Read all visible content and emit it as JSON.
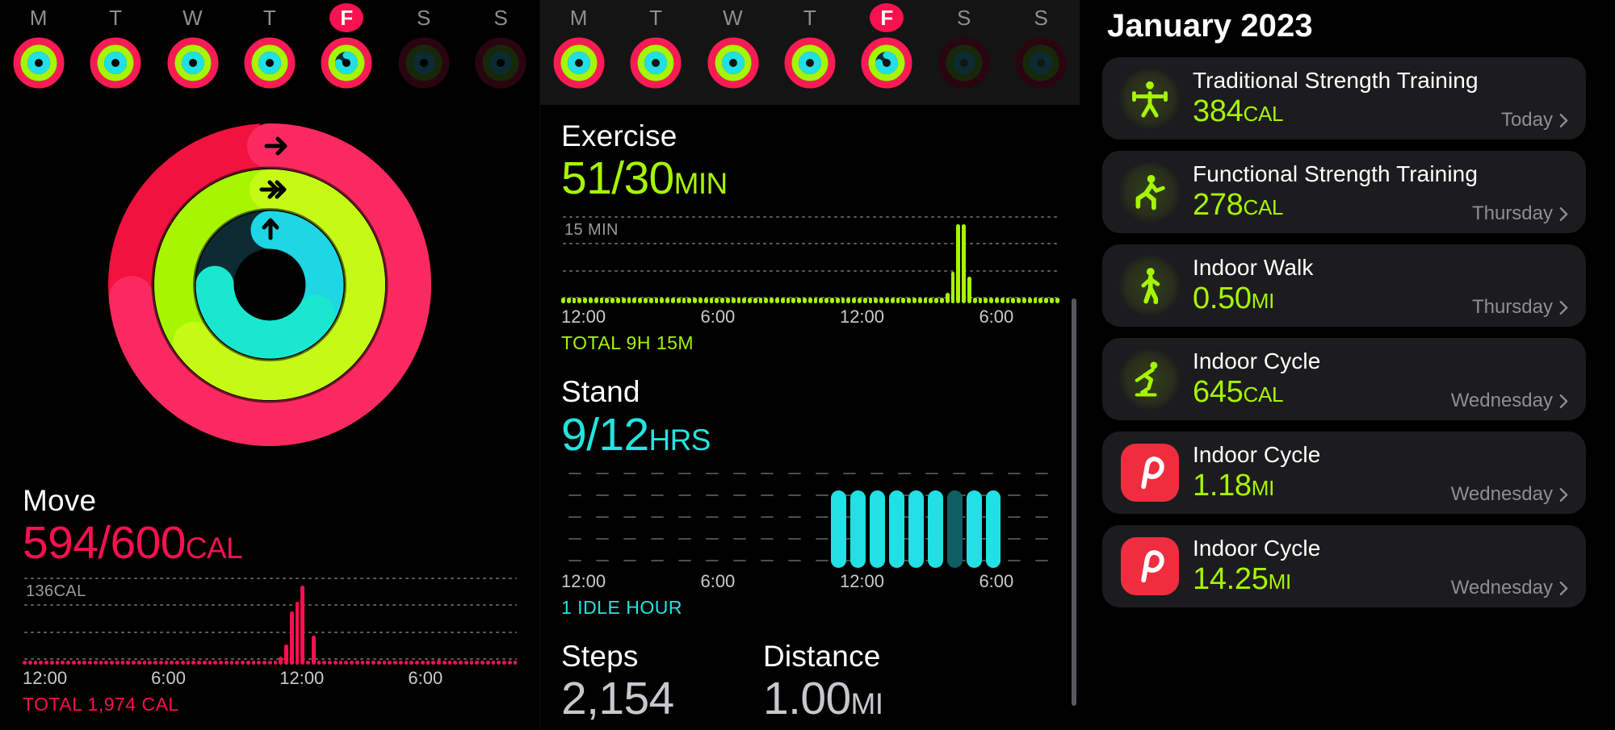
{
  "week_strip": {
    "days": [
      {
        "label": "M",
        "today": false,
        "move_pct": 113,
        "exercise_pct": 100,
        "stand_pct": 100,
        "dimmed": false
      },
      {
        "label": "T",
        "today": false,
        "move_pct": 108,
        "exercise_pct": 100,
        "stand_pct": 100,
        "dimmed": false
      },
      {
        "label": "W",
        "today": false,
        "move_pct": 100,
        "exercise_pct": 100,
        "stand_pct": 100,
        "dimmed": false
      },
      {
        "label": "T",
        "today": false,
        "move_pct": 110,
        "exercise_pct": 100,
        "stand_pct": 100,
        "dimmed": false
      },
      {
        "label": "F",
        "today": true,
        "move_pct": 99,
        "exercise_pct": 100,
        "stand_pct": 75,
        "dimmed": false
      },
      {
        "label": "S",
        "today": false,
        "move_pct": 0,
        "exercise_pct": 0,
        "stand_pct": 0,
        "dimmed": true
      },
      {
        "label": "S",
        "today": false,
        "move_pct": 0,
        "exercise_pct": 0,
        "stand_pct": 0,
        "dimmed": true
      }
    ]
  },
  "rings": {
    "move_pct": 99,
    "exercise_pct": 170,
    "stand_pct": 75,
    "move_arrow": "single-chevron-arrow",
    "exercise_arrow": "double-chevron-arrow",
    "stand_arrow": "up-arrow"
  },
  "move": {
    "name": "Move",
    "value": "594/600",
    "unit": "CAL",
    "color": "#fa114f"
  },
  "exercise": {
    "name": "Exercise",
    "value": "51/30",
    "unit": "MIN",
    "color": "#a6f501"
  },
  "stand": {
    "name": "Stand",
    "value": "9/12",
    "unit": "HRS",
    "color": "#21e5e0"
  },
  "steps": {
    "name": "Steps",
    "value": "2,154"
  },
  "distance": {
    "name": "Distance",
    "value": "1.00",
    "unit": "MI"
  },
  "workouts": {
    "month_title": "January 2023",
    "items": [
      {
        "title": "Traditional Strength Training",
        "value": "384",
        "unit": "CAL",
        "day": "Today",
        "icon": "strength-training-icon",
        "icon_kind": "glyph"
      },
      {
        "title": "Functional Strength Training",
        "value": "278",
        "unit": "CAL",
        "day": "Thursday",
        "icon": "functional-strength-icon",
        "icon_kind": "glyph"
      },
      {
        "title": "Indoor Walk",
        "value": "0.50",
        "unit": "MI",
        "day": "Thursday",
        "icon": "walk-icon",
        "icon_kind": "glyph"
      },
      {
        "title": "Indoor Cycle",
        "value": "645",
        "unit": "CAL",
        "day": "Wednesday",
        "icon": "cycle-icon",
        "icon_kind": "glyph"
      },
      {
        "title": "Indoor Cycle",
        "value": "1.18",
        "unit": "MI",
        "day": "Wednesday",
        "icon": "peloton-app-icon",
        "icon_kind": "app"
      },
      {
        "title": "Indoor Cycle",
        "value": "14.25",
        "unit": "MI",
        "day": "Wednesday",
        "icon": "peloton-app-icon",
        "icon_kind": "app"
      }
    ]
  },
  "chart_data": [
    {
      "type": "bar",
      "title": "Move",
      "ylabel": "136CAL",
      "ymax_label": "136CAL",
      "total_label": "TOTAL 1,974 CAL",
      "color": "#fa114f",
      "grid": true,
      "xticks": [
        "12:00",
        "6:00",
        "12:00",
        "6:00"
      ],
      "xtick_positions_pct": [
        0,
        26,
        52,
        78
      ],
      "ylim": [
        0,
        136
      ],
      "values": [
        2,
        2,
        2,
        2,
        2,
        2,
        2,
        2,
        2,
        2,
        2,
        2,
        2,
        2,
        2,
        2,
        2,
        2,
        2,
        2,
        2,
        2,
        2,
        2,
        2,
        2,
        2,
        2,
        2,
        2,
        2,
        2,
        2,
        2,
        2,
        2,
        2,
        2,
        2,
        2,
        2,
        2,
        2,
        2,
        2,
        3,
        7,
        14,
        34,
        92,
        108,
        136,
        2,
        50,
        4,
        2,
        2,
        2,
        2,
        2,
        2,
        2,
        2,
        2,
        2,
        2,
        2,
        2,
        2,
        6,
        2,
        2,
        2,
        2,
        2,
        6,
        9,
        2,
        2,
        7,
        2,
        2,
        2,
        2,
        2,
        2,
        2,
        2,
        2,
        2,
        2
      ]
    },
    {
      "type": "bar",
      "title": "Exercise",
      "ylabel": "15 MIN",
      "ymax_label": "15 MIN",
      "total_label": "TOTAL 9H 15M",
      "color": "#a6f501",
      "grid": true,
      "xticks": [
        "12:00",
        "6:00",
        "12:00",
        "6:00"
      ],
      "xtick_positions_pct": [
        0,
        28,
        56,
        84
      ],
      "ylim": [
        0,
        15
      ],
      "values": [
        1,
        1,
        1,
        1,
        1,
        1,
        1,
        1,
        1,
        1,
        1,
        1,
        1,
        1,
        1,
        1,
        1,
        1,
        1,
        1,
        1,
        1,
        1,
        1,
        1,
        1,
        1,
        1,
        1,
        1,
        1,
        1,
        1,
        1,
        1,
        1,
        1,
        1,
        1,
        1,
        1,
        1,
        1,
        1,
        1,
        1,
        1,
        1,
        1,
        1,
        1,
        1,
        1,
        1,
        1,
        1,
        1,
        1,
        1,
        1,
        1,
        1,
        1,
        1,
        1,
        1,
        1,
        1,
        1,
        1,
        2,
        6,
        15,
        15,
        5,
        1,
        1,
        1,
        1,
        1,
        1,
        1,
        1,
        1,
        1,
        1,
        1,
        1,
        1,
        1,
        1
      ]
    },
    {
      "type": "bar",
      "title": "Stand",
      "total_label": "1 IDLE HOUR",
      "color": "#21e5e0",
      "grid": true,
      "xticks": [
        "12:00",
        "6:00",
        "12:00",
        "6:00"
      ],
      "xtick_positions_pct": [
        0,
        28,
        56,
        84
      ],
      "hours": [
        0,
        0,
        0,
        0,
        0,
        0,
        0,
        0,
        0,
        0,
        0,
        0,
        0,
        0,
        1,
        1,
        1,
        1,
        1,
        1,
        0.45,
        1,
        1,
        0,
        0,
        0
      ],
      "bar_start_index": 14,
      "bar_count": 9,
      "idle_index": 20
    }
  ]
}
